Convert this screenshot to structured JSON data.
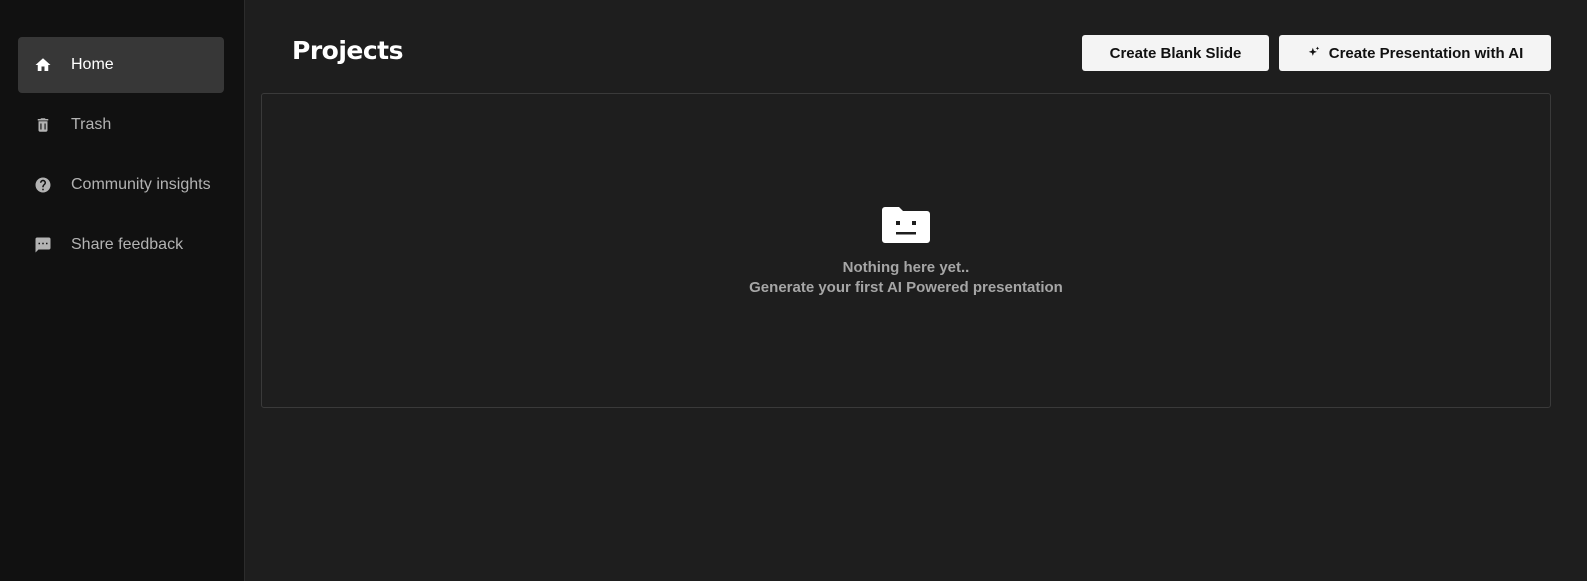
{
  "sidebar": {
    "items": [
      {
        "label": "Home",
        "icon": "home-icon",
        "active": true
      },
      {
        "label": "Trash",
        "icon": "trash-icon",
        "active": false
      },
      {
        "label": "Community insights",
        "icon": "help-circle-icon",
        "active": false
      },
      {
        "label": "Share feedback",
        "icon": "feedback-icon",
        "active": false
      }
    ]
  },
  "header": {
    "title": "Projects",
    "create_blank_label": "Create Blank Slide",
    "create_ai_label": "Create Presentation with AI"
  },
  "empty_state": {
    "icon": "sad-folder-icon",
    "line1": "Nothing here yet..",
    "line2": "Generate your first AI Powered presentation"
  },
  "colors": {
    "background": "#1e1e1e",
    "sidebar": "#111111",
    "active_item": "#373737",
    "button": "#f4f4f4"
  }
}
